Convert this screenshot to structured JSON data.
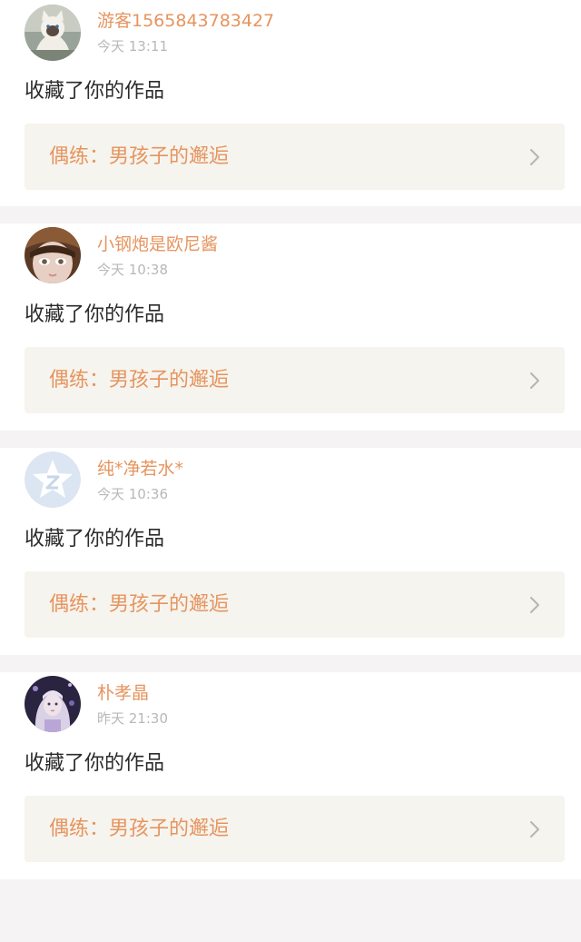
{
  "notifications": [
    {
      "username": "游客1565843783427",
      "time": "今天 13:11",
      "action": "收藏了你的作品",
      "work_title": "偶练：男孩子的邂逅",
      "avatar_icon": "cat-photo-avatar"
    },
    {
      "username": "小钢炮是欧尼酱",
      "time": "今天 10:38",
      "action": "收藏了你的作品",
      "work_title": "偶练：男孩子的邂逅",
      "avatar_icon": "doll-photo-avatar"
    },
    {
      "username": "纯*净若水*",
      "time": "今天 10:36",
      "action": "收藏了你的作品",
      "work_title": "偶练：男孩子的邂逅",
      "avatar_icon": "default-star-avatar"
    },
    {
      "username": "朴孝晶",
      "time": "昨天 21:30",
      "action": "收藏了你的作品",
      "work_title": "偶练：男孩子的邂逅",
      "avatar_icon": "girl-photo-avatar"
    }
  ],
  "colors": {
    "accent": "#e6945f",
    "card_link_bg": "#f6f4ee",
    "separator": "#f5f3f3",
    "timestamp": "#b8b8b8",
    "text": "#2b2b2b"
  }
}
